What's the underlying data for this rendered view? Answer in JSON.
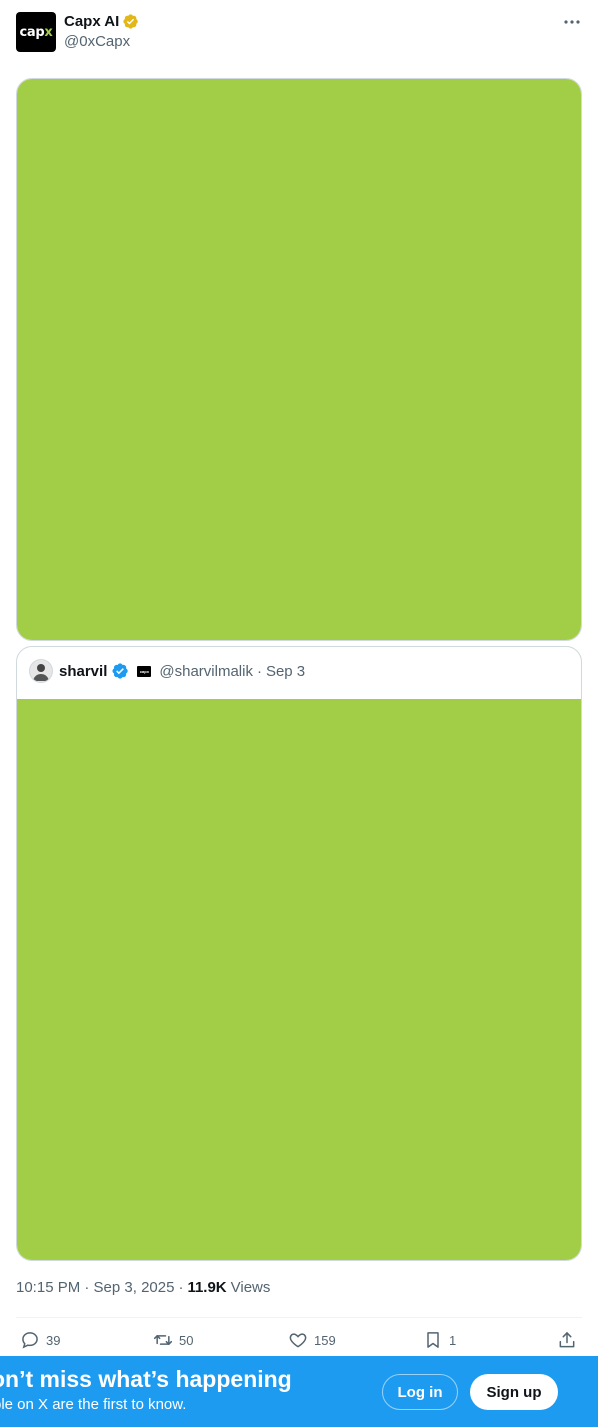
{
  "post": {
    "author": {
      "name": "Capx AI",
      "handle": "@0xCapx",
      "avatar_text_main": "cap",
      "avatar_text_accent": "x"
    },
    "more_icon": "more-horizontal-icon",
    "media_color": "#a2ce47",
    "timestamp": "10:15 PM · Sep 3, 2025",
    "separator": "·",
    "views_count": "11.9K",
    "views_label": "Views"
  },
  "quote": {
    "name": "sharvil",
    "handle": "@sharvilmalik",
    "separator": "·",
    "date": "Sep 3",
    "affiliate_text": "capx",
    "media_color": "#a2ce47"
  },
  "actions": {
    "replies": "39",
    "reposts": "50",
    "likes": "159",
    "bookmarks": "1"
  },
  "banner": {
    "title": "on’t miss what’s happening",
    "subtitle": "ple on X are the first to know.",
    "login_label": "Log in",
    "signup_label": "Sign up"
  },
  "colors": {
    "brand_blue": "#1d9bf0",
    "verified_gold": "#e2b719",
    "verified_blue": "#1d9bf0",
    "muted_text": "#536471"
  }
}
